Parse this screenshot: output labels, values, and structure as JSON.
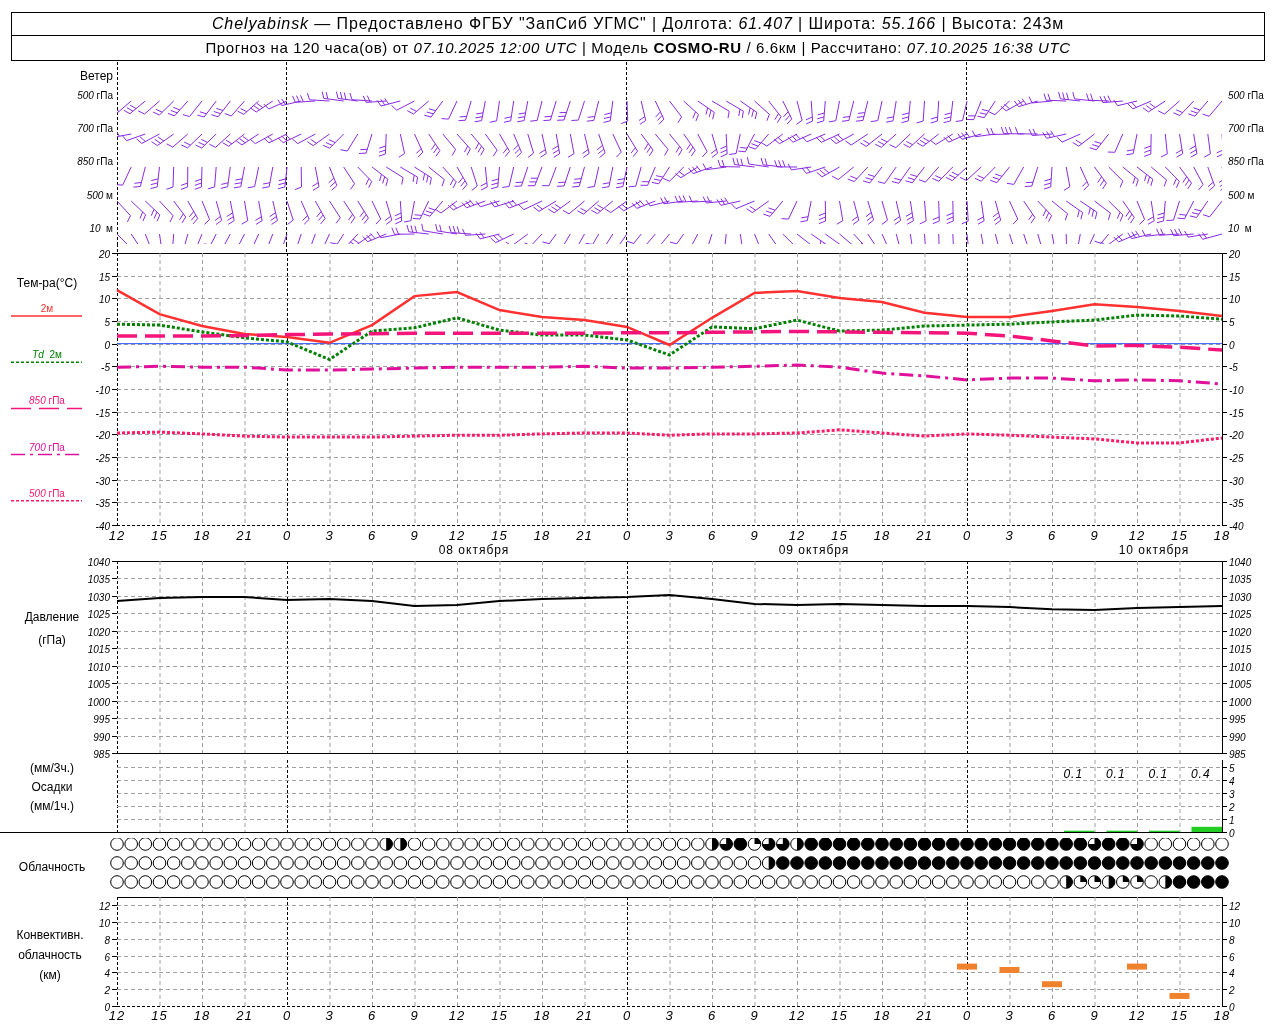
{
  "header": {
    "line_1": "*Chelyabinsk* — Предоставлено ФГБУ \"ЗапСиб УГМС\" | Долгота: *61.407* | Широта: *55.166* | Высота: 243м",
    "line_2": "Прогноз на 120 часа(ов) от *07.10.2025 12:00 UTC* | Модель **COSMO-RU** / 6.6км | Рассчитано: *07.10.2025 16:38 UTC*"
  },
  "wind": {
    "title": "Ветер",
    "levels": [
      {
        "left": "*500* гПа",
        "right": "*500* гПа"
      },
      {
        "left": "*700* гПа",
        "right": "*700* гПа"
      },
      {
        "left": "*850* гПа",
        "right": "*850* гПа"
      },
      {
        "left": "*500* м",
        "right": "*500* м"
      },
      {
        "left": "*10*  м",
        "right": "*10*  м"
      }
    ]
  },
  "temperature": {
    "title": "Тем-ра(°C)",
    "left_axis_labels": [
      "20",
      "15",
      "10",
      "5",
      "0",
      "-5",
      "-10",
      "-15",
      "-20",
      "-25",
      "-30",
      "-35",
      "-40"
    ],
    "right_axis_labels": [
      "20",
      "15",
      "10",
      "5",
      "0",
      "-5",
      "-10",
      "-15",
      "-20",
      "-25",
      "-30",
      "-35",
      "-40"
    ],
    "dates": [
      "08 октября",
      "09 октября",
      "10 октября"
    ],
    "chart_data": {
      "type": "line",
      "grid": true,
      "categories": [
        "12",
        "15",
        "18",
        "21",
        "0",
        "3",
        "6",
        "9",
        "12",
        "15",
        "18",
        "21",
        "0",
        "3",
        "6",
        "9",
        "12",
        "15",
        "18",
        "21",
        "0",
        "3",
        "6",
        "9",
        "12",
        "15",
        "18"
      ],
      "ylim": [
        -40,
        20
      ],
      "yticks": [
        20,
        15,
        10,
        5,
        0,
        -5,
        -10,
        -15,
        -20,
        -25,
        -30,
        -35,
        -40
      ],
      "ref_lines": [
        {
          "axis": "y",
          "value": 0,
          "color": "#2050ff"
        }
      ],
      "series": [
        {
          "name": "2м",
          "line_style": "solid",
          "color": "#ff3030",
          "values": [
            11.8,
            6.5,
            3.9,
            2.1,
            1.5,
            0.2,
            4.1,
            10.5,
            11.4,
            7.4,
            5.9,
            5.2,
            3.7,
            -0.3,
            5.7,
            11.2,
            11.6,
            10.1,
            9.2,
            6.8,
            5.9,
            5.9,
            7.2,
            8.7,
            8.1,
            7.2,
            6.1
          ]
        },
        {
          "name": "*Td*  2м",
          "line_style": "dotted",
          "color": "#008000",
          "values": [
            4.3,
            4.1,
            2.6,
            1.3,
            0.4,
            -3.5,
            2.8,
            3.5,
            5.7,
            3.0,
            1.9,
            1.9,
            0.8,
            -2.5,
            3.7,
            3.3,
            5.2,
            2.8,
            3.0,
            3.9,
            4.1,
            4.3,
            4.8,
            5.2,
            6.3,
            6.1,
            5.4
          ]
        },
        {
          "name": "*850* гПа",
          "line_style": "dashed",
          "color": "#f5147a",
          "values": [
            1.7,
            1.7,
            1.7,
            1.8,
            2.0,
            2.1,
            2.2,
            2.3,
            2.3,
            2.3,
            2.3,
            2.3,
            2.4,
            2.4,
            2.5,
            2.6,
            2.7,
            2.6,
            2.5,
            2.4,
            2.3,
            1.7,
            0.6,
            -0.5,
            -0.4,
            -0.8,
            -1.4
          ]
        },
        {
          "name": "*700* гПа",
          "line_style": "dashdot",
          "color": "#e0109a",
          "values": [
            -5.2,
            -5.0,
            -5.2,
            -5.2,
            -5.8,
            -5.8,
            -5.6,
            -5.4,
            -5.2,
            -5.2,
            -5.2,
            -5.0,
            -5.4,
            -5.4,
            -5.2,
            -5.0,
            -4.7,
            -5.2,
            -6.5,
            -7.1,
            -8.0,
            -7.6,
            -7.6,
            -8.2,
            -8.0,
            -8.2,
            -8.9
          ]
        },
        {
          "name": "*500* гПа",
          "line_style": "dotted",
          "color": "#ff1a66",
          "values": [
            -19.7,
            -19.5,
            -19.9,
            -20.4,
            -20.6,
            -20.6,
            -20.6,
            -20.4,
            -20.2,
            -20.2,
            -19.9,
            -19.7,
            -19.7,
            -20.2,
            -19.9,
            -19.9,
            -19.7,
            -19.0,
            -19.7,
            -20.4,
            -19.9,
            -20.2,
            -20.6,
            -21.0,
            -21.9,
            -21.9,
            -20.8
          ]
        }
      ]
    }
  },
  "pressure": {
    "label_lines": [
      "Давление",
      "(гПа)"
    ],
    "right_axis_labels": [
      "1040",
      "1035",
      "1030",
      "1025",
      "1020",
      "1015",
      "1010",
      "1005",
      "1000",
      "995",
      "990",
      "985"
    ],
    "chart_data": {
      "type": "line",
      "grid": true,
      "ylim": [
        985,
        1040
      ],
      "yticks": [
        1040,
        1035,
        1030,
        1025,
        1020,
        1015,
        1010,
        1005,
        1000,
        995,
        990,
        985
      ],
      "series": [
        {
          "color": "#000000",
          "values": [
            1028.5,
            1029.4,
            1029.7,
            1029.7,
            1028.8,
            1029.1,
            1028.5,
            1027.1,
            1027.4,
            1028.5,
            1029.1,
            1029.4,
            1029.7,
            1030.3,
            1029.1,
            1027.7,
            1027.4,
            1027.7,
            1027.4,
            1027.1,
            1027.1,
            1026.8,
            1026.2,
            1026.0,
            1026.5,
            1026.8,
            1027.1
          ]
        }
      ]
    }
  },
  "precipitation": {
    "label_lines": [
      "(мм/3ч.)",
      "Осадки",
      "(мм/1ч.)"
    ],
    "chart_data": {
      "type": "bar",
      "grid": true,
      "ylim": [
        0,
        5
      ],
      "yticks": [
        5,
        4,
        3,
        2,
        1,
        0
      ],
      "values": [
        null,
        null,
        null,
        null,
        null,
        null,
        null,
        null,
        null,
        null,
        null,
        null,
        null,
        null,
        null,
        null,
        null,
        null,
        null,
        null,
        null,
        null,
        0.1,
        0.1,
        0.1,
        0.4
      ],
      "annotations": [
        "0.1",
        "0.1",
        "0.1",
        "0.4"
      ]
    }
  },
  "clouds": {
    "label": "Облачность",
    "rows": [
      {
        "cells": [
          {
            "kind": "clear"
          },
          {
            "kind": "clear"
          },
          {
            "kind": "clear"
          },
          {
            "kind": "clear"
          },
          {
            "kind": "clear"
          },
          {
            "kind": "clear"
          },
          {
            "kind": "clear"
          },
          {
            "kind": "clear"
          },
          {
            "kind": "clear"
          },
          {
            "kind": "clear"
          },
          {
            "kind": "clear"
          },
          {
            "kind": "clear"
          },
          {
            "kind": "clear"
          },
          {
            "kind": "clear"
          },
          {
            "kind": "clear"
          },
          {
            "kind": "clear"
          },
          {
            "kind": "clear"
          },
          {
            "kind": "clear"
          },
          {
            "kind": "clear"
          },
          {
            "kind": "half"
          },
          {
            "kind": "half"
          },
          {
            "kind": "clear"
          },
          {
            "kind": "clear"
          },
          {
            "kind": "clear"
          },
          {
            "kind": "clear"
          },
          {
            "kind": "clear"
          },
          {
            "kind": "clear"
          },
          {
            "kind": "clear"
          },
          {
            "kind": "clear"
          },
          {
            "kind": "clear"
          },
          {
            "kind": "clear"
          },
          {
            "kind": "clear"
          },
          {
            "kind": "clear"
          },
          {
            "kind": "clear"
          },
          {
            "kind": "clear"
          },
          {
            "kind": "clear"
          },
          {
            "kind": "clear"
          },
          {
            "kind": "clear"
          },
          {
            "kind": "clear"
          },
          {
            "kind": "clear"
          },
          {
            "kind": "clear"
          },
          {
            "kind": "clear"
          },
          {
            "kind": "half"
          },
          {
            "kind": "most"
          },
          {
            "kind": "overcast"
          },
          {
            "kind": "quarter"
          },
          {
            "kind": "most"
          },
          {
            "kind": "most"
          },
          {
            "kind": "half"
          },
          {
            "kind": "overcast"
          },
          {
            "kind": "overcast"
          },
          {
            "kind": "overcast"
          },
          {
            "kind": "overcast"
          },
          {
            "kind": "overcast"
          },
          {
            "kind": "overcast"
          },
          {
            "kind": "overcast"
          },
          {
            "kind": "overcast"
          },
          {
            "kind": "overcast"
          },
          {
            "kind": "overcast"
          },
          {
            "kind": "overcast"
          },
          {
            "kind": "overcast"
          },
          {
            "kind": "overcast"
          },
          {
            "kind": "overcast"
          },
          {
            "kind": "overcast"
          },
          {
            "kind": "overcast"
          },
          {
            "kind": "overcast"
          },
          {
            "kind": "overcast"
          },
          {
            "kind": "overcast"
          },
          {
            "kind": "overcast"
          },
          {
            "kind": "most"
          },
          {
            "kind": "overcast"
          },
          {
            "kind": "overcast"
          },
          {
            "kind": "most"
          },
          {
            "kind": "clear"
          },
          {
            "kind": "clear"
          },
          {
            "kind": "clear"
          },
          {
            "kind": "clear"
          },
          {
            "kind": "clear"
          },
          {
            "kind": "clear"
          }
        ]
      },
      {
        "cells": [
          {
            "kind": "clear"
          },
          {
            "kind": "clear"
          },
          {
            "kind": "clear"
          },
          {
            "kind": "clear"
          },
          {
            "kind": "clear"
          },
          {
            "kind": "clear"
          },
          {
            "kind": "clear"
          },
          {
            "kind": "clear"
          },
          {
            "kind": "clear"
          },
          {
            "kind": "clear"
          },
          {
            "kind": "clear"
          },
          {
            "kind": "clear"
          },
          {
            "kind": "clear"
          },
          {
            "kind": "clear"
          },
          {
            "kind": "clear"
          },
          {
            "kind": "clear"
          },
          {
            "kind": "clear"
          },
          {
            "kind": "clear"
          },
          {
            "kind": "clear"
          },
          {
            "kind": "clear"
          },
          {
            "kind": "clear"
          },
          {
            "kind": "clear"
          },
          {
            "kind": "clear"
          },
          {
            "kind": "clear"
          },
          {
            "kind": "clear"
          },
          {
            "kind": "clear"
          },
          {
            "kind": "clear"
          },
          {
            "kind": "clear"
          },
          {
            "kind": "clear"
          },
          {
            "kind": "clear"
          },
          {
            "kind": "clear"
          },
          {
            "kind": "clear"
          },
          {
            "kind": "clear"
          },
          {
            "kind": "clear"
          },
          {
            "kind": "clear"
          },
          {
            "kind": "clear"
          },
          {
            "kind": "clear"
          },
          {
            "kind": "clear"
          },
          {
            "kind": "clear"
          },
          {
            "kind": "clear"
          },
          {
            "kind": "clear"
          },
          {
            "kind": "clear"
          },
          {
            "kind": "clear"
          },
          {
            "kind": "clear"
          },
          {
            "kind": "clear"
          },
          {
            "kind": "clear"
          },
          {
            "kind": "half"
          },
          {
            "kind": "overcast"
          },
          {
            "kind": "overcast"
          },
          {
            "kind": "overcast"
          },
          {
            "kind": "overcast"
          },
          {
            "kind": "overcast"
          },
          {
            "kind": "overcast"
          },
          {
            "kind": "overcast"
          },
          {
            "kind": "overcast"
          },
          {
            "kind": "overcast"
          },
          {
            "kind": "overcast"
          },
          {
            "kind": "overcast"
          },
          {
            "kind": "overcast"
          },
          {
            "kind": "overcast"
          },
          {
            "kind": "overcast"
          },
          {
            "kind": "overcast"
          },
          {
            "kind": "overcast"
          },
          {
            "kind": "overcast"
          },
          {
            "kind": "overcast"
          },
          {
            "kind": "overcast"
          },
          {
            "kind": "overcast"
          },
          {
            "kind": "overcast"
          },
          {
            "kind": "overcast"
          },
          {
            "kind": "overcast"
          },
          {
            "kind": "overcast"
          },
          {
            "kind": "overcast"
          },
          {
            "kind": "overcast"
          },
          {
            "kind": "overcast"
          },
          {
            "kind": "overcast"
          },
          {
            "kind": "overcast"
          },
          {
            "kind": "overcast"
          },
          {
            "kind": "overcast"
          },
          {
            "kind": "overcast"
          }
        ]
      },
      {
        "cells": [
          {
            "kind": "clear"
          },
          {
            "kind": "clear"
          },
          {
            "kind": "clear"
          },
          {
            "kind": "clear"
          },
          {
            "kind": "clear"
          },
          {
            "kind": "clear"
          },
          {
            "kind": "clear"
          },
          {
            "kind": "clear"
          },
          {
            "kind": "clear"
          },
          {
            "kind": "clear"
          },
          {
            "kind": "clear"
          },
          {
            "kind": "clear"
          },
          {
            "kind": "clear"
          },
          {
            "kind": "clear"
          },
          {
            "kind": "clear"
          },
          {
            "kind": "clear"
          },
          {
            "kind": "clear"
          },
          {
            "kind": "clear"
          },
          {
            "kind": "clear"
          },
          {
            "kind": "clear"
          },
          {
            "kind": "clear"
          },
          {
            "kind": "clear"
          },
          {
            "kind": "clear"
          },
          {
            "kind": "clear"
          },
          {
            "kind": "clear"
          },
          {
            "kind": "clear"
          },
          {
            "kind": "clear"
          },
          {
            "kind": "clear"
          },
          {
            "kind": "clear"
          },
          {
            "kind": "clear"
          },
          {
            "kind": "clear"
          },
          {
            "kind": "clear"
          },
          {
            "kind": "clear"
          },
          {
            "kind": "clear"
          },
          {
            "kind": "clear"
          },
          {
            "kind": "clear"
          },
          {
            "kind": "clear"
          },
          {
            "kind": "clear"
          },
          {
            "kind": "clear"
          },
          {
            "kind": "clear"
          },
          {
            "kind": "clear"
          },
          {
            "kind": "clear"
          },
          {
            "kind": "clear"
          },
          {
            "kind": "clear"
          },
          {
            "kind": "clear"
          },
          {
            "kind": "clear"
          },
          {
            "kind": "clear"
          },
          {
            "kind": "clear"
          },
          {
            "kind": "clear"
          },
          {
            "kind": "clear"
          },
          {
            "kind": "clear"
          },
          {
            "kind": "clear"
          },
          {
            "kind": "clear"
          },
          {
            "kind": "clear"
          },
          {
            "kind": "clear"
          },
          {
            "kind": "clear"
          },
          {
            "kind": "clear"
          },
          {
            "kind": "clear"
          },
          {
            "kind": "clear"
          },
          {
            "kind": "clear"
          },
          {
            "kind": "clear"
          },
          {
            "kind": "clear"
          },
          {
            "kind": "clear"
          },
          {
            "kind": "clear"
          },
          {
            "kind": "clear"
          },
          {
            "kind": "clear"
          },
          {
            "kind": "clear"
          },
          {
            "kind": "half"
          },
          {
            "kind": "quarter"
          },
          {
            "kind": "quarter"
          },
          {
            "kind": "half"
          },
          {
            "kind": "quarter"
          },
          {
            "kind": "quarter"
          },
          {
            "kind": "clear"
          },
          {
            "kind": "half"
          },
          {
            "kind": "overcast"
          },
          {
            "kind": "overcast"
          },
          {
            "kind": "overcast"
          },
          {
            "kind": "overcast"
          }
        ]
      }
    ]
  },
  "convective_clouds": {
    "label_lines": [
      "Конвективн.",
      "облачность",
      "(км)"
    ],
    "left_axis_labels": [
      "12",
      "10",
      "8",
      "6",
      "4",
      "2",
      "0"
    ],
    "right_axis_labels": [
      "12",
      "10",
      "8",
      "6",
      "4",
      "2",
      "0"
    ],
    "chart_data": {
      "type": "scatter",
      "grid": true,
      "ylim": [
        0,
        13
      ],
      "yticks": [
        12,
        10,
        8,
        6,
        4,
        2,
        0
      ],
      "categories": [
        "12",
        "15",
        "18",
        "21",
        "0",
        "3",
        "6",
        "9",
        "12",
        "15",
        "18",
        "21",
        "0",
        "3",
        "6",
        "9",
        "12",
        "15",
        "18",
        "21",
        "0",
        "3",
        "6",
        "9",
        "12",
        "15",
        "18"
      ],
      "values": [
        null,
        null,
        null,
        null,
        null,
        null,
        null,
        null,
        null,
        null,
        null,
        null,
        null,
        null,
        null,
        null,
        null,
        null,
        null,
        null,
        4.7,
        4.3,
        2.6,
        null,
        4.7,
        1.2,
        null
      ]
    }
  }
}
